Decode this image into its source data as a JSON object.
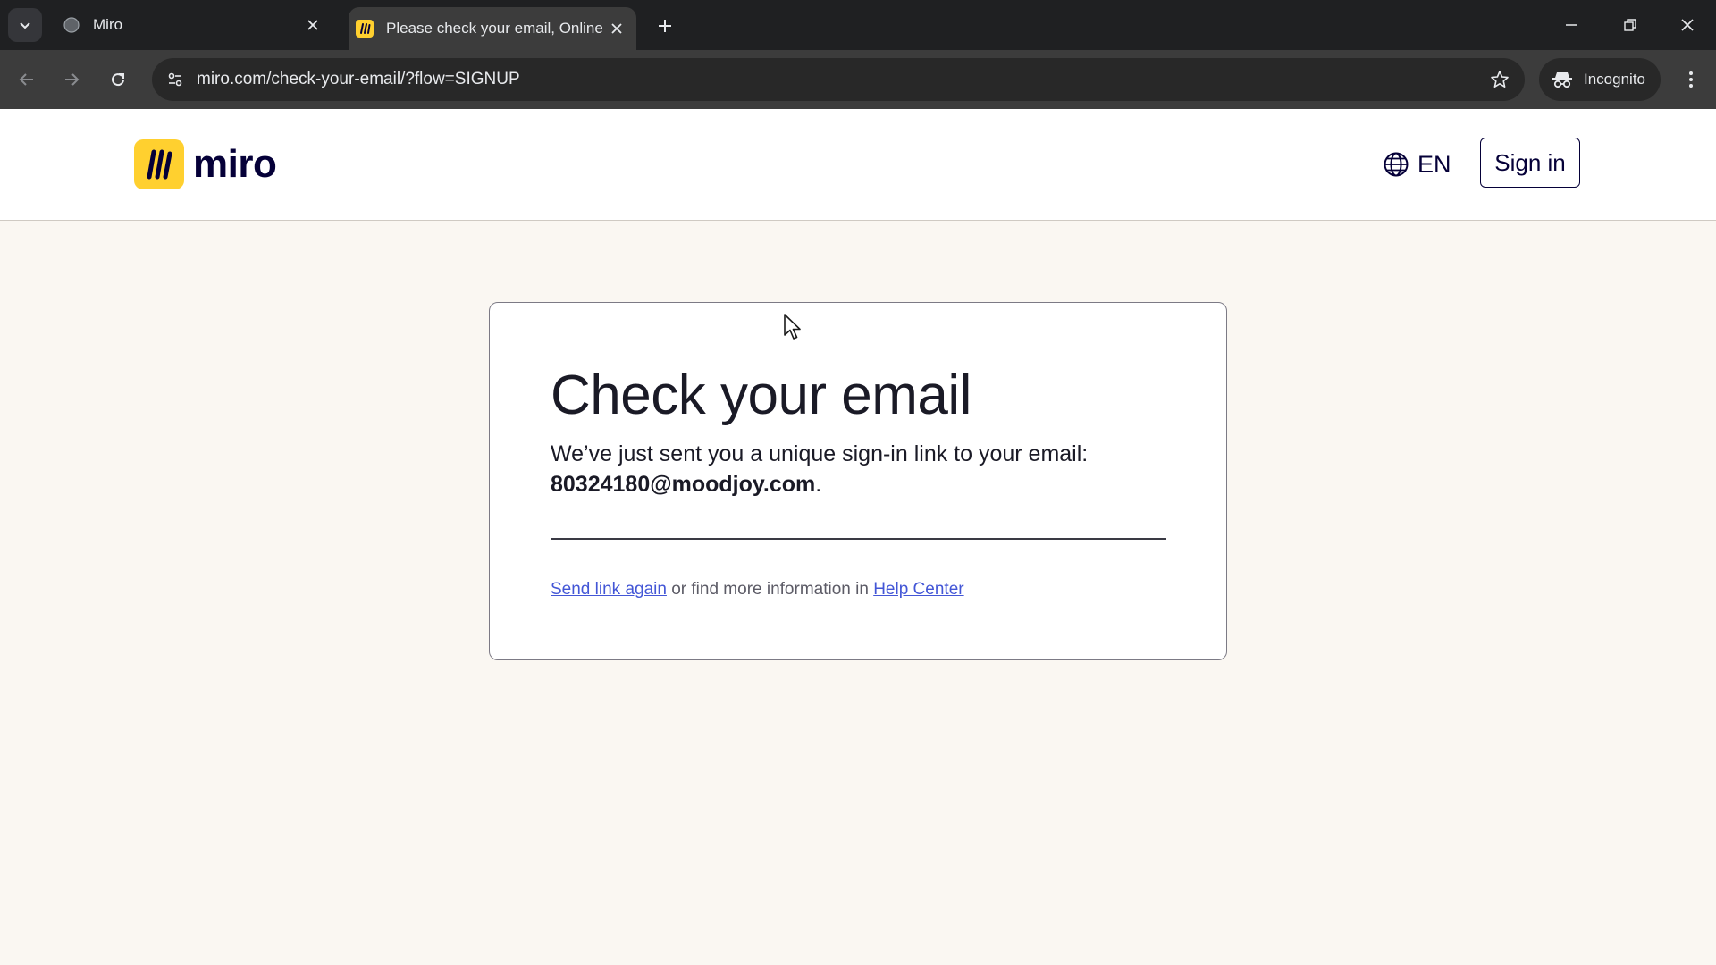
{
  "browser": {
    "tabs": [
      {
        "title": "Miro",
        "active": false
      },
      {
        "title": "Please check your email, Online",
        "active": true
      }
    ],
    "url": "miro.com/check-your-email/?flow=SIGNUP",
    "incognito_label": "Incognito"
  },
  "header": {
    "logo_text": "miro",
    "language_code": "EN",
    "signin_label": "Sign in"
  },
  "card": {
    "heading": "Check your email",
    "body_text": "We’ve just sent you a unique sign-in link to your email:",
    "email": "80324180@moodjoy.com",
    "email_suffix": ".",
    "send_again_label": "Send link again",
    "middle_text": " or find more information in ",
    "help_center_label": "Help Center"
  },
  "colors": {
    "brand_yellow": "#ffd02f",
    "brand_navy": "#050038",
    "link_blue": "#4356d6",
    "page_background": "#faf7f2"
  }
}
